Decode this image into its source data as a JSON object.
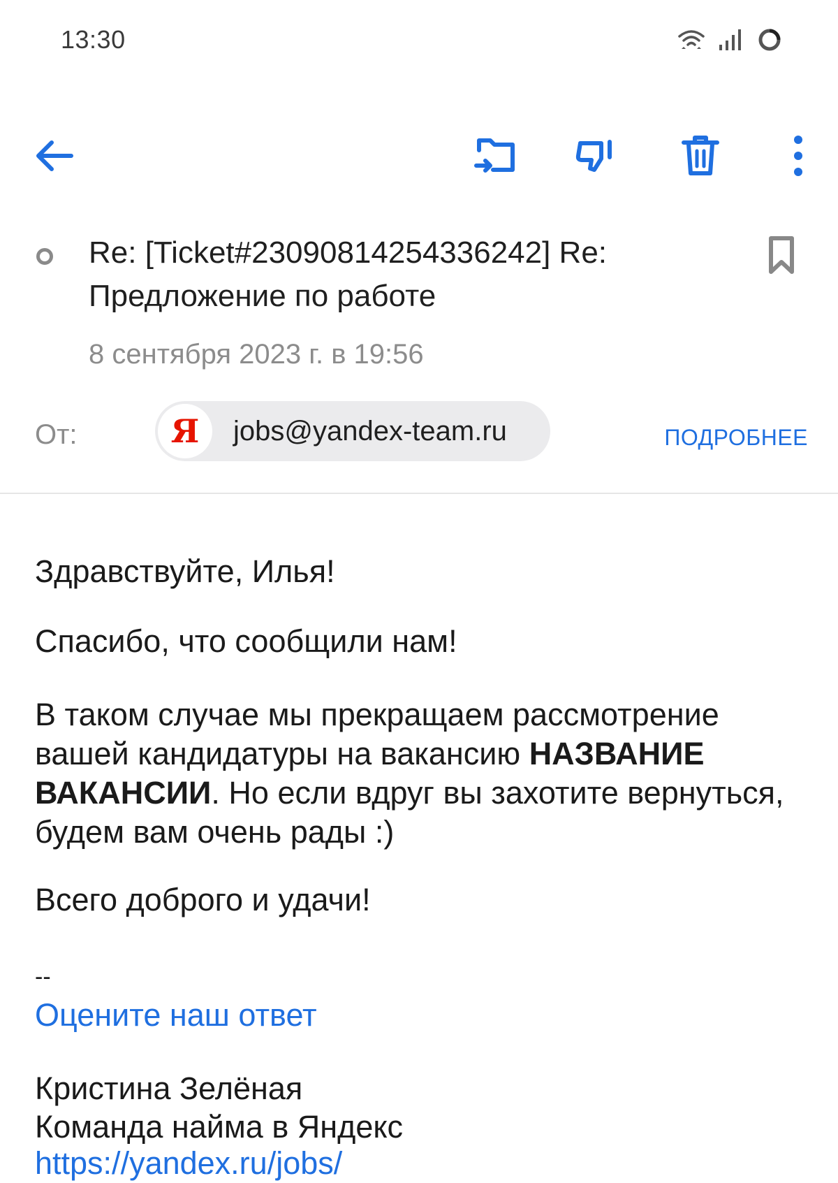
{
  "status_bar": {
    "time": "13:30",
    "icons": [
      "wifi-icon",
      "signal-icon",
      "battery-icon"
    ]
  },
  "toolbar": {
    "icons": [
      "back-arrow-icon",
      "move-to-folder-icon",
      "spam-icon",
      "trash-icon",
      "more-vertical-icon"
    ],
    "accent_color": "#1f6fe0"
  },
  "message": {
    "subject": "Re: [Ticket#2309081425433624​2] Re: Предложение по работе",
    "date": "8 сентября 2023 г. в 19:56",
    "from_label": "От:",
    "sender": {
      "avatar_letter": "Я",
      "email": "jobs@yandex-team.ru"
    },
    "details_link": "ПОДРОБНЕЕ"
  },
  "body": {
    "greeting": "Здравствуйте, Илья!",
    "thanks": "Спасибо, что сообщили нам!",
    "main_before": "В таком случае мы прекращаем рассмотрение вашей кандидатуры на вакансию ",
    "main_bold": "НАЗВАНИЕ ВАКАНСИИ",
    "main_after": ". Но если вдруг вы захотите вернуться, будем вам очень рады :)",
    "goodbye": "Всего доброго и удачи!",
    "separator": "--",
    "rate_link": "Оцените наш ответ",
    "signature_name": "Кристина Зелёная",
    "signature_team": "Команда найма в Яндекс",
    "signature_url": "https://yandex.ru/jobs/"
  }
}
